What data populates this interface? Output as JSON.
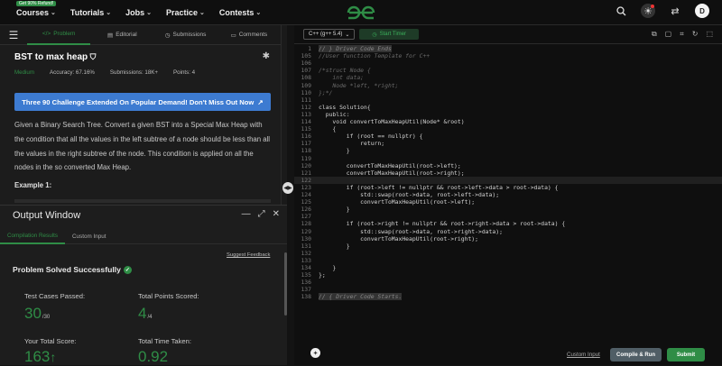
{
  "nav": {
    "promo": "Get 90% Refund!",
    "items": [
      {
        "label": "Courses"
      },
      {
        "label": "Tutorials"
      },
      {
        "label": "Jobs"
      },
      {
        "label": "Practice"
      },
      {
        "label": "Contests"
      }
    ],
    "avatar": "D"
  },
  "tabs": [
    {
      "label": "Problem",
      "icon": "code-icon"
    },
    {
      "label": "Editorial",
      "icon": "book-icon"
    },
    {
      "label": "Submissions",
      "icon": "clock-icon"
    },
    {
      "label": "Comments",
      "icon": "comment-icon"
    }
  ],
  "problem": {
    "title": "BST to max heap",
    "difficulty": "Medium",
    "accuracy": "Accuracy: 67.16%",
    "submissions": "Submissions: 18K+",
    "points": "Points: 4",
    "banner": "Three 90 Challenge Extended On Popular Demand! Don't Miss Out Now",
    "description": "Given a Binary Search Tree. Convert a given BST into a Special Max Heap with the condition that all the values in the left subtree of a node should be less than all the values in the right subtree of the node. This condition is applied on all the nodes in the so converted Max Heap.",
    "example_label": "Example 1:"
  },
  "output": {
    "title": "Output Window",
    "tabs": [
      "Compilation Results",
      "Custom Input"
    ],
    "suggest": "Suggest Feedback",
    "status": "Problem Solved Successfully",
    "stats": {
      "tests_label": "Test Cases Passed:",
      "tests_value": "30",
      "tests_total": "/30",
      "points_label": "Total Points Scored:",
      "points_value": "4",
      "points_total": "/4",
      "score_label": "Your Total Score:",
      "score_value": "163",
      "time_label": "Total Time Taken:",
      "time_value": "0.92"
    }
  },
  "editor": {
    "language": "C++ (g++ 5.4)",
    "timer": "Start Timer",
    "lines": [
      {
        "n": "1",
        "t": "// } Driver Code Ends",
        "c": "fold"
      },
      {
        "n": "105",
        "t": "//User function Template for C++",
        "c": "cm"
      },
      {
        "n": "106",
        "t": "",
        "c": ""
      },
      {
        "n": "107",
        "t": "/*struct Node {",
        "c": "cm"
      },
      {
        "n": "108",
        "t": "    int data;",
        "c": "cm"
      },
      {
        "n": "109",
        "t": "    Node *left, *right;",
        "c": "cm"
      },
      {
        "n": "110",
        "t": "};*/",
        "c": "cm"
      },
      {
        "n": "111",
        "t": "",
        "c": ""
      },
      {
        "n": "112",
        "t": "class Solution{",
        "c": ""
      },
      {
        "n": "113",
        "t": "  public:",
        "c": ""
      },
      {
        "n": "114",
        "t": "    void convertToMaxHeapUtil(Node* &root)",
        "c": ""
      },
      {
        "n": "115",
        "t": "    {",
        "c": ""
      },
      {
        "n": "116",
        "t": "        if (root == nullptr) {",
        "c": ""
      },
      {
        "n": "117",
        "t": "            return;",
        "c": ""
      },
      {
        "n": "118",
        "t": "        }",
        "c": ""
      },
      {
        "n": "119",
        "t": "",
        "c": ""
      },
      {
        "n": "120",
        "t": "        convertToMaxHeapUtil(root->left);",
        "c": ""
      },
      {
        "n": "121",
        "t": "        convertToMaxHeapUtil(root->right);",
        "c": ""
      },
      {
        "n": "122",
        "t": "",
        "c": "hl"
      },
      {
        "n": "123",
        "t": "        if (root->left != nullptr && root->left->data > root->data) {",
        "c": ""
      },
      {
        "n": "124",
        "t": "            std::swap(root->data, root->left->data);",
        "c": ""
      },
      {
        "n": "125",
        "t": "            convertToMaxHeapUtil(root->left);",
        "c": ""
      },
      {
        "n": "126",
        "t": "        }",
        "c": ""
      },
      {
        "n": "127",
        "t": "",
        "c": ""
      },
      {
        "n": "128",
        "t": "        if (root->right != nullptr && root->right->data > root->data) {",
        "c": ""
      },
      {
        "n": "129",
        "t": "            std::swap(root->data, root->right->data);",
        "c": ""
      },
      {
        "n": "130",
        "t": "            convertToMaxHeapUtil(root->right);",
        "c": ""
      },
      {
        "n": "131",
        "t": "        }",
        "c": ""
      },
      {
        "n": "132",
        "t": "",
        "c": ""
      },
      {
        "n": "133",
        "t": "",
        "c": ""
      },
      {
        "n": "134",
        "t": "    }",
        "c": ""
      },
      {
        "n": "135",
        "t": "};",
        "c": ""
      },
      {
        "n": "136",
        "t": "",
        "c": ""
      },
      {
        "n": "137",
        "t": "",
        "c": ""
      },
      {
        "n": "138",
        "t": "// { Driver Code Starts.",
        "c": "fold"
      }
    ],
    "custom_input": "Custom Input",
    "compile": "Compile & Run",
    "submit": "Submit"
  },
  "colors": {
    "accent": "#2f8d46",
    "banner": "#3d7bd1"
  }
}
